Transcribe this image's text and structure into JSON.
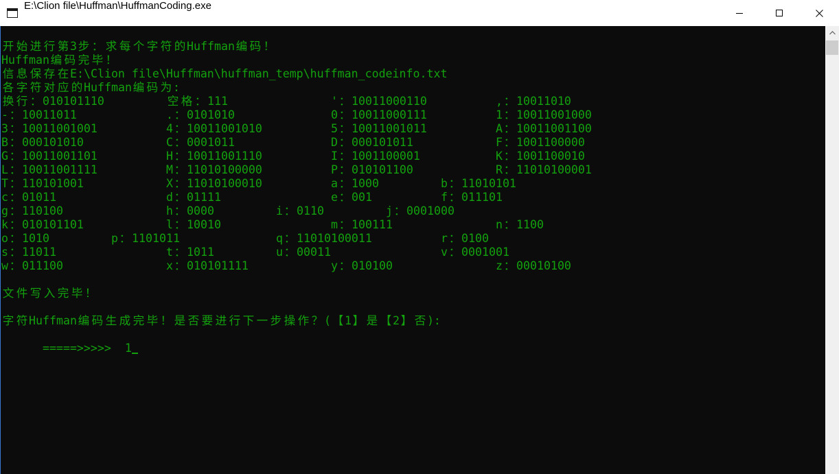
{
  "window": {
    "title": "E:\\Clion file\\Huffman\\HuffmanCoding.exe",
    "icon": "console-app-icon",
    "buttons": {
      "minimize": "minimize-icon",
      "maximize": "maximize-icon",
      "close": "close-icon"
    }
  },
  "colors": {
    "console_text": "#13a10e",
    "console_background": "#0c0c0c",
    "title_bar": "#ffffff",
    "scrollbar_track": "#f0f0f0",
    "scrollbar_thumb": "#cdcdcd"
  },
  "console": {
    "step_start": "开始进行第3步：求每个字符的Huffman编码！",
    "coding_done": "Huffman编码完毕！",
    "saved_to": "信息保存在E:\\Clion file\\Huffman\\huffman_temp\\huffman_codeinfo.txt",
    "table_heading": "各字符对应的Huffman编码为:",
    "code_table": [
      [
        "换行：010101110",
        "空格：111",
        "'：10011000110",
        ",：10011010"
      ],
      [
        "-：10011011",
        ".：0101010",
        "0：10011000111",
        "1：10011001000"
      ],
      [
        "3：10011001001",
        "4：10011001010",
        "5：10011001011",
        "A：10011001100"
      ],
      [
        "B：000101010",
        "C：0001011",
        "D：000101011",
        "F：1001100000"
      ],
      [
        "G：10011001101",
        "H：10011001110",
        "I：1001100001",
        "K：1001100010"
      ],
      [
        "L：10011001111",
        "M：11010100000",
        "P：010101100",
        "R：11010100001"
      ],
      [
        "T：110101001",
        "X：11010100010",
        "a：1000",
        "b：11010101"
      ],
      [
        "c：01011",
        "d：01111",
        "e：001",
        "f：011101"
      ],
      [
        "g：110100",
        "h：0000",
        "i：0110",
        "j：0001000"
      ],
      [
        "k：010101101",
        "l：10010",
        "m：100111",
        "n：1100"
      ],
      [
        "o：1010",
        "p：1101011",
        "q：11010100011",
        "r：0100"
      ],
      [
        "s：11011",
        "t：1011",
        "u：00011",
        "v：0001001"
      ],
      [
        "w：011100",
        "x：010101111",
        "y：010100",
        "z：00010100"
      ]
    ],
    "file_written": "文件写入完毕！",
    "next_step_prompt": "字符Huffman编码生成完毕！是否要进行下一步操作？(【1】是【2】否):",
    "input_prompt": "=====>>>>>  ",
    "user_input": "1"
  },
  "scrollbar": {
    "up_arrow": "chevron-up-icon",
    "position": 0
  }
}
